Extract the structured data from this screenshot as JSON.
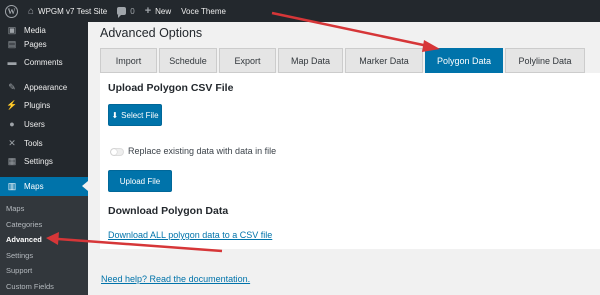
{
  "admin_bar": {
    "site_name": "WPGM v7 Test Site",
    "comments_count": "0",
    "new_label": "New",
    "theme_label": "Voce Theme"
  },
  "sidebar": {
    "items": [
      {
        "label": "Media",
        "icon": "media-icon"
      },
      {
        "label": "Pages",
        "icon": "pages-icon"
      },
      {
        "label": "Comments",
        "icon": "comments-icon"
      },
      {
        "label": "Appearance",
        "icon": "appearance-icon"
      },
      {
        "label": "Plugins",
        "icon": "plugins-icon"
      },
      {
        "label": "Users",
        "icon": "users-icon"
      },
      {
        "label": "Tools",
        "icon": "tools-icon"
      },
      {
        "label": "Settings",
        "icon": "settings-icon"
      },
      {
        "label": "Maps",
        "icon": "maps-icon"
      }
    ],
    "submenu": [
      "Maps",
      "Categories",
      "Advanced",
      "Settings",
      "Support",
      "Custom Fields"
    ]
  },
  "page": {
    "title": "Advanced Options",
    "tabs": [
      "Import",
      "Schedule",
      "Export",
      "Map Data",
      "Marker Data",
      "Polygon Data",
      "Polyline Data"
    ],
    "active_tab": "Polygon Data",
    "upload_heading": "Upload Polygon CSV File",
    "select_file_label": "Select File",
    "replace_label": "Replace existing data with data in file",
    "upload_button_label": "Upload File",
    "download_heading": "Download Polygon Data",
    "download_link": "Download ALL polygon data to a CSV file",
    "help_link": "Need help? Read the documentation."
  },
  "colors": {
    "accent": "#0073aa",
    "admin_dark": "#23282d",
    "annotation_arrow": "#d63638"
  }
}
